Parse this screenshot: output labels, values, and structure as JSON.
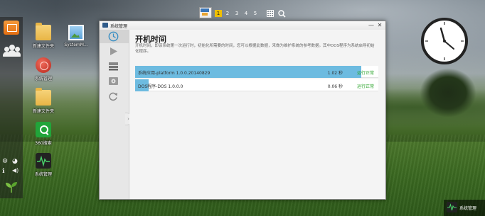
{
  "desktop": {
    "icons": [
      {
        "label": "新建文件夹"
      },
      {
        "label": "SystemM..."
      },
      {
        "label": "系统管理"
      },
      {
        "label": "新建文件夹"
      },
      {
        "label": "360搜索"
      },
      {
        "label": "系统管理"
      }
    ]
  },
  "topbar": {
    "pages": [
      "1",
      "2",
      "3",
      "4",
      "5"
    ],
    "active_page": "1",
    "icons": [
      "desktop-thumbnail-icon",
      "grid-icon",
      "search-icon"
    ]
  },
  "window": {
    "title": "系统管理",
    "minimize_glyph": "—",
    "close_glyph": "✕",
    "side_tabs": [
      "clock-icon",
      "play-icon",
      "stack-icon",
      "disk-icon",
      "refresh-icon"
    ],
    "heading": "开机时间",
    "description": "开机时间，即该系统第一次运行时，初始化所需要的时间，您可以根据此数据，来做为维护系统的参考数据。其中DOS程序为系统启导初始化程序。",
    "rows": [
      {
        "name": "系统应用-platform 1.0.0.20140829",
        "time": "1.02 秒",
        "status": "运行正常",
        "progress": 0.93
      },
      {
        "name": "DOS程序-DOS 1.0.0.0",
        "time": "0.06 秒",
        "status": "运行正常",
        "progress": 0.055
      }
    ]
  },
  "taskbar": {
    "item_label": "系统管理"
  },
  "colors": {
    "progress": "#6dbbe0",
    "status_ok": "#2aa42a",
    "active_page": "#f0c000",
    "sidebar_app": "#e56f12"
  }
}
